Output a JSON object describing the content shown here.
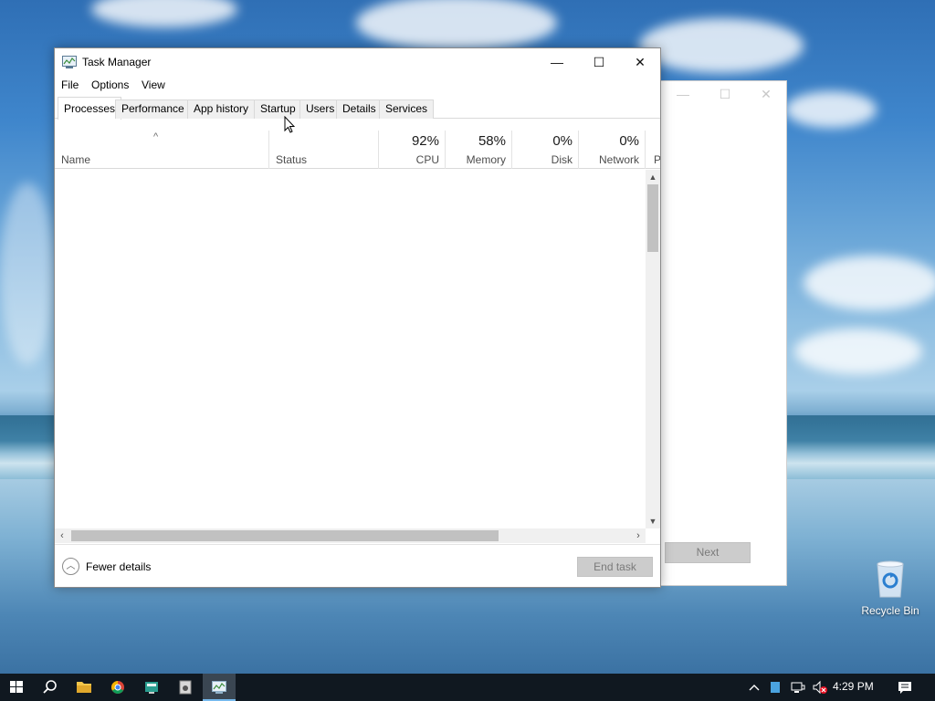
{
  "task_manager": {
    "title": "Task Manager",
    "window_controls": {
      "minimize": "—",
      "maximize": "☐",
      "close": "✕"
    },
    "menu": [
      "File",
      "Options",
      "View"
    ],
    "tabs": [
      "Processes",
      "Performance",
      "App history",
      "Startup",
      "Users",
      "Details",
      "Services"
    ],
    "active_tab": "Processes",
    "columns": {
      "name": {
        "label": "Name",
        "sort_indicator": "^"
      },
      "status": {
        "label": "Status"
      },
      "cpu": {
        "label": "CPU",
        "value": "92%"
      },
      "memory": {
        "label": "Memory",
        "value": "58%"
      },
      "disk": {
        "label": "Disk",
        "value": "0%"
      },
      "network": {
        "label": "Network",
        "value": "0%"
      },
      "power": {
        "label": "P"
      }
    },
    "footer": {
      "fewer_details": "Fewer details",
      "end_task": "End task"
    }
  },
  "back_window": {
    "next_label": "Next"
  },
  "desktop": {
    "recycle_bin_label": "Recycle Bin"
  },
  "taskbar": {
    "clock": "4:29 PM",
    "apps": [
      "start-icon",
      "search-icon",
      "file-explorer-icon",
      "chrome-icon",
      "app-icon",
      "setup-icon",
      "task-manager-icon"
    ]
  },
  "colors": {
    "taskbar": "#101820",
    "accent": "#76b9ed",
    "disabled_button": "#cccccc"
  }
}
